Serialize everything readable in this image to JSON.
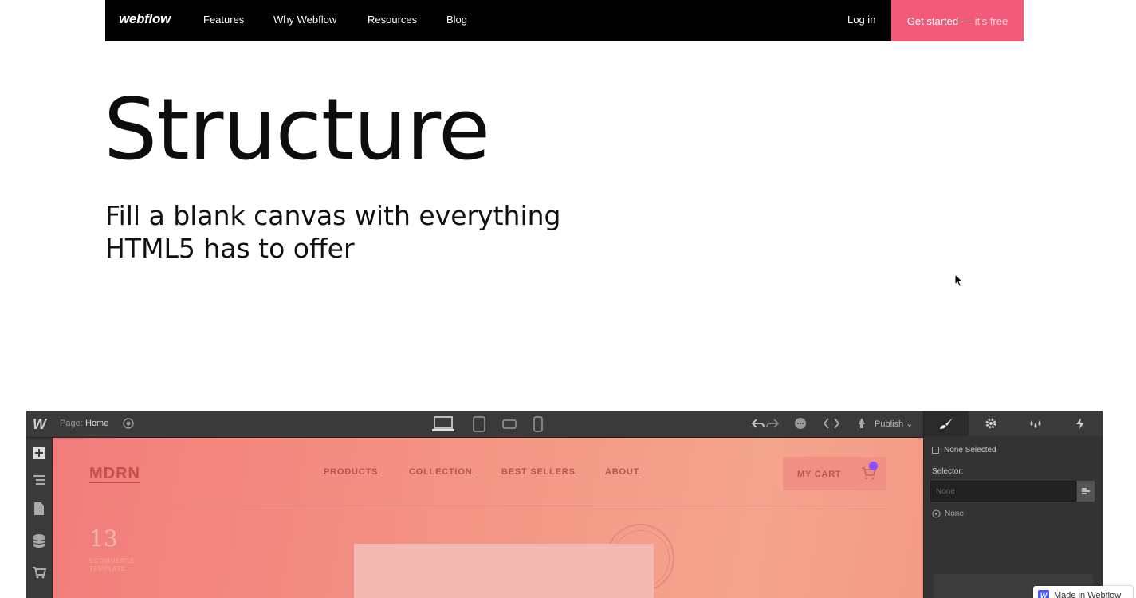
{
  "topnav": {
    "logo": "webflow",
    "links": [
      "Features",
      "Why Webflow",
      "Resources",
      "Blog"
    ],
    "login": "Log in",
    "cta_main": "Get started",
    "cta_sub": "— it's free"
  },
  "hero": {
    "title": "Structure",
    "subtitle_line1": "Fill a blank canvas with everything",
    "subtitle_line2": "HTML5 has to offer"
  },
  "designer": {
    "logo": "W",
    "page_label": "Page:",
    "page_value": "Home",
    "publish_label": "Publish",
    "right_panel": {
      "none_selected": "None Selected",
      "selector_label": "Selector:",
      "selector_placeholder": "None",
      "none_row": "None"
    },
    "canvas": {
      "brand": "MDRN",
      "nav": [
        "PRODUCTS",
        "COLLECTION",
        "BEST SELLERS",
        "ABOUT"
      ],
      "cart": "MY CART",
      "number": "13",
      "small_text_1": "ECOMMERCE",
      "small_text_2": "TEMPLATE"
    }
  },
  "badge": {
    "icon_letter": "W",
    "text": "Made in Webflow"
  },
  "colors": {
    "cta": "#f15a79",
    "badge_blue": "#4353ff",
    "cart_dot": "#8a4fff"
  }
}
